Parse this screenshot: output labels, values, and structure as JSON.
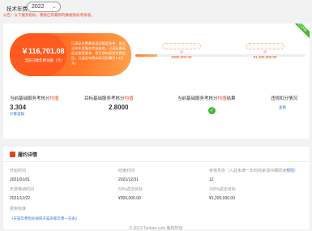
{
  "header": {
    "fee_label": "技术年费",
    "year_selected": "2022",
    "notice": "公告：以下服务指标，需按已有最新的数据指标考核值。"
  },
  "promo": {
    "amount": "￥116,701.08",
    "amount_sub": "当前已缴年费总额（元）",
    "description": "已满足年费最高返还额度条件，截至当年年度服务考核结束，已满足最高返还额度要求，您可期待享受年费返还，已返还年费实际可折算为1.2万元。"
  },
  "progress": {
    "fill_fraction": 0.13,
    "mid_value": "¥300,000.00",
    "end_value": "¥1,200,000.00",
    "ribbon": "已达标"
  },
  "metrics": [
    {
      "title_pre": "当前基础服务考核分",
      "title_red": "均值",
      "value": "3.304",
      "link": "计算逻辑"
    },
    {
      "title_pre": "目标基础服务考核分",
      "title_red": "均值",
      "value": "2.8000",
      "link": ""
    },
    {
      "title_pre": "当前基础服务考核分",
      "title_red": "均值",
      "title_post": "结果",
      "value": "",
      "link": ""
    },
    {
      "title_pre": "违规扣分情况",
      "title_red": "",
      "value": "",
      "link": "查看"
    }
  ],
  "performance": {
    "title": "履约详情",
    "start_label": "开始时间",
    "start_value": "2021/01/01",
    "end_label": "结束时间",
    "end_value": "2021/12/31",
    "months_label": "考核月份（入驻未满一年的商家请仔细阅读",
    "months_link": "规则",
    "months_label_end": "）",
    "months_value": "12",
    "fee_date_label": "年费缴纳时间",
    "fee_date_value": "2021/12/22",
    "target50_label": "50%返还目标",
    "target50_value": "¥300,000.00",
    "target100_label": "100%返还目标",
    "target100_value": "¥1,200,000.00",
    "standard_label": "费用标准",
    "standard_link": "《天猫年费指标按照天猫商家年费一览表》"
  },
  "footer": {
    "copyright": "© 2013 Taobao.com 版权所有"
  }
}
